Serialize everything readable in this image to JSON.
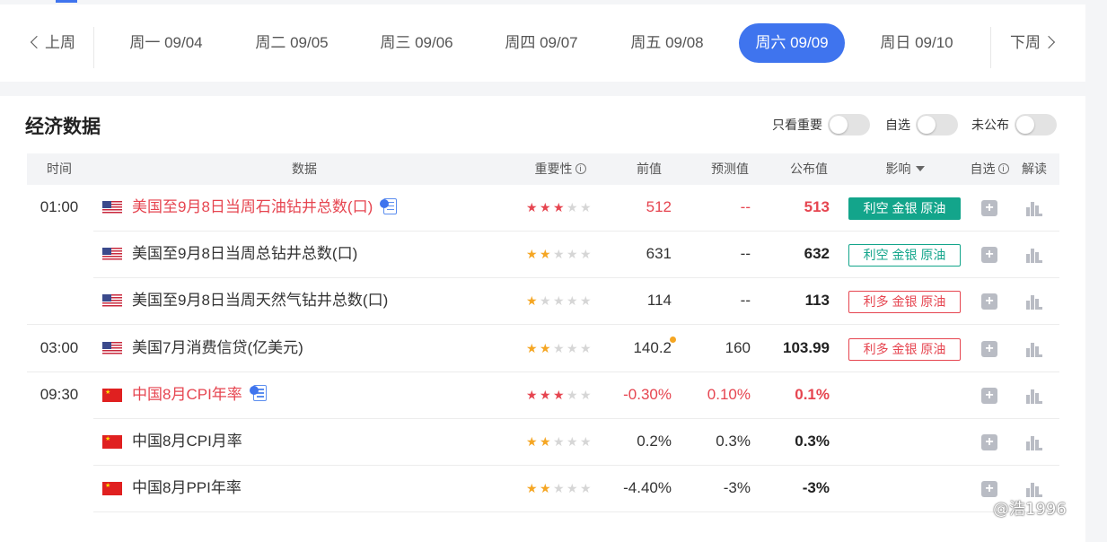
{
  "week_nav": {
    "prev_label": "上周",
    "next_label": "下周",
    "days": [
      {
        "label": "周一 09/04",
        "active": false
      },
      {
        "label": "周二 09/05",
        "active": false
      },
      {
        "label": "周三 09/06",
        "active": false
      },
      {
        "label": "周四 09/07",
        "active": false
      },
      {
        "label": "周五 09/08",
        "active": false
      },
      {
        "label": "周六 09/09",
        "active": true
      },
      {
        "label": "周日 09/10",
        "active": false
      }
    ]
  },
  "section": {
    "title": "经济数据",
    "filters": [
      {
        "label": "只看重要",
        "on": false
      },
      {
        "label": "自选",
        "on": false
      },
      {
        "label": "未公布",
        "on": false
      }
    ]
  },
  "table": {
    "headers": {
      "time": "时间",
      "data": "数据",
      "importance": "重要性",
      "previous": "前值",
      "forecast": "预测值",
      "actual": "公布值",
      "impact": "影响",
      "watch": "自选",
      "analysis": "解读"
    },
    "rows": [
      {
        "time": "01:00",
        "flag": "us",
        "name": "美国至9月8日当周石油钻井总数(口)",
        "name_red": true,
        "has_doc": true,
        "stars": 3,
        "star_color": "red",
        "previous": "512",
        "forecast": "--",
        "actual": "513",
        "value_red": true,
        "impact": "利空 金银 原油",
        "impact_style": "teal-solid"
      },
      {
        "time": "",
        "flag": "us",
        "name": "美国至9月8日当周总钻井总数(口)",
        "name_red": false,
        "has_doc": false,
        "stars": 2,
        "star_color": "yellow",
        "previous": "631",
        "forecast": "--",
        "actual": "632",
        "value_red": false,
        "impact": "利空 金银 原油",
        "impact_style": "teal"
      },
      {
        "time": "",
        "flag": "us",
        "name": "美国至9月8日当周天然气钻井总数(口)",
        "name_red": false,
        "has_doc": false,
        "stars": 1,
        "star_color": "yellow",
        "previous": "114",
        "forecast": "--",
        "actual": "113",
        "value_red": false,
        "impact": "利多 金银 原油",
        "impact_style": "red"
      },
      {
        "time": "03:00",
        "flag": "us",
        "name": "美国7月消费信贷(亿美元)",
        "name_red": false,
        "has_doc": false,
        "stars": 2,
        "star_color": "yellow",
        "previous": "140.2",
        "forecast": "160",
        "actual": "103.99",
        "value_red": false,
        "impact": "利多 金银 原油",
        "impact_style": "red",
        "revised_dot": true
      },
      {
        "time": "09:30",
        "flag": "cn",
        "name": "中国8月CPI年率",
        "name_red": true,
        "has_doc": true,
        "stars": 3,
        "star_color": "red",
        "previous": "-0.30%",
        "forecast": "0.10%",
        "actual": "0.1%",
        "value_red": true,
        "impact": "",
        "impact_style": ""
      },
      {
        "time": "",
        "flag": "cn",
        "name": "中国8月CPI月率",
        "name_red": false,
        "has_doc": false,
        "stars": 2,
        "star_color": "yellow",
        "previous": "0.2%",
        "forecast": "0.3%",
        "actual": "0.3%",
        "value_red": false,
        "impact": "",
        "impact_style": ""
      },
      {
        "time": "",
        "flag": "cn",
        "name": "中国8月PPI年率",
        "name_red": false,
        "has_doc": false,
        "stars": 2,
        "star_color": "yellow",
        "previous": "-4.40%",
        "forecast": "-3%",
        "actual": "-3%",
        "value_red": false,
        "impact": "",
        "impact_style": ""
      }
    ]
  },
  "watermark": "@浩1996",
  "colors": {
    "accent": "#3f74ee",
    "bearish": "#13a58b",
    "bullish": "#e64550"
  }
}
